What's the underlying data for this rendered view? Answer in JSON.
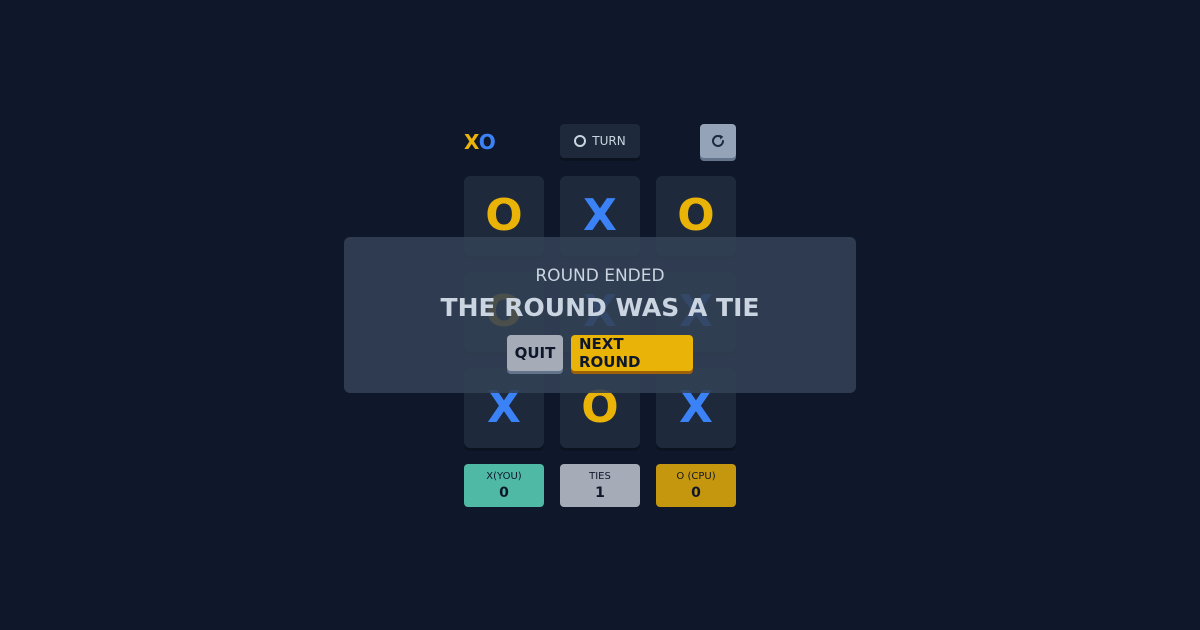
{
  "header": {
    "logo_x": "X",
    "logo_o": "O",
    "turn_label": "TURN",
    "turn_icon": "o-ring-icon",
    "restart_icon": "restart-icon"
  },
  "board": {
    "cells": [
      "O",
      "X",
      "O",
      "O",
      "X",
      "X",
      "X",
      "O",
      "X"
    ]
  },
  "scores": {
    "x": {
      "label": "X(YOU)",
      "value": "0"
    },
    "ties": {
      "label": "TIES",
      "value": "1"
    },
    "o": {
      "label": "O (CPU)",
      "value": "0"
    }
  },
  "modal": {
    "subtitle": "ROUND ENDED",
    "title": "THE ROUND WAS A TIE",
    "quit_label": "QUIT",
    "next_label": "NEXT ROUND"
  },
  "colors": {
    "background": "#0f172a",
    "x_mark": "#3b82f6",
    "o_mark": "#eab308",
    "x_score": "#4fb9a5",
    "ties_score": "#a5acb8",
    "o_score": "#c4970e"
  }
}
